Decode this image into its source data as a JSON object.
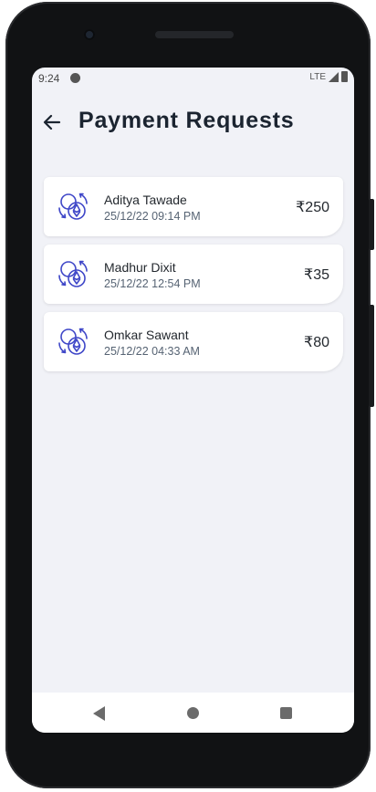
{
  "status_bar": {
    "time": "9:24",
    "network": "LTE"
  },
  "header": {
    "title": "Payment Requests"
  },
  "requests": [
    {
      "name": "Aditya Tawade",
      "datetime": "25/12/22 09:14 PM",
      "amount": "₹250"
    },
    {
      "name": "Madhur Dixit",
      "datetime": "25/12/22 12:54 PM",
      "amount": "₹35"
    },
    {
      "name": "Omkar Sawant",
      "datetime": "25/12/22 04:33 AM",
      "amount": "₹80"
    }
  ],
  "icons": {
    "back": "arrow-left-icon",
    "request": "crypto-exchange-icon",
    "nav": [
      "nav-back-icon",
      "nav-home-icon",
      "nav-recents-icon"
    ]
  },
  "colors": {
    "accent": "#3f47c8",
    "background": "#f1f2f7",
    "text": "#1b2430",
    "subtext": "#566373"
  }
}
